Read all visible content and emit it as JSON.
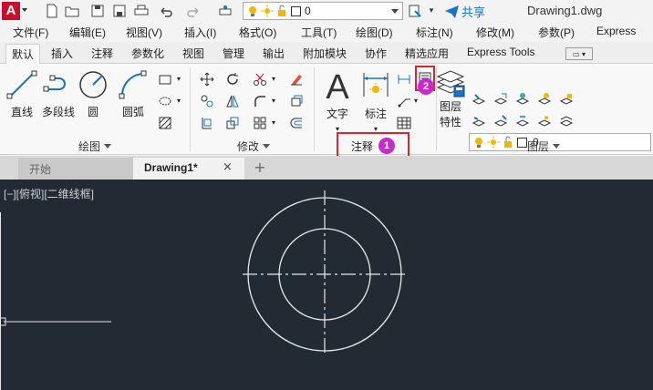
{
  "app": {
    "logo_letter": "A",
    "doc_title": "Drawing1.dwg",
    "share_label": "共享",
    "layer_value": "0"
  },
  "menu": [
    "文件(F)",
    "编辑(E)",
    "视图(V)",
    "插入(I)",
    "格式(O)",
    "工具(T)",
    "绘图(D)",
    "标注(N)",
    "修改(M)",
    "参数(P)",
    "Express"
  ],
  "ribbon_tabs": [
    "默认",
    "插入",
    "注释",
    "参数化",
    "视图",
    "管理",
    "输出",
    "附加模块",
    "协作",
    "精选应用",
    "Express Tools"
  ],
  "draw_panel": {
    "title": "绘图",
    "line": "直线",
    "polyline": "多段线",
    "circle": "圆",
    "arc": "圆弧"
  },
  "modify_panel": {
    "title": "修改"
  },
  "annotation_panel": {
    "title": "注释",
    "text": "文字",
    "dimension": "标注"
  },
  "layers_panel": {
    "title": "图层",
    "properties_line1": "图层",
    "properties_line2": "特性",
    "layer_value": "0"
  },
  "markers": {
    "badge1": "1",
    "badge2": "2"
  },
  "doc_tabs": {
    "start": "开始",
    "drawing": "Drawing1*",
    "close": "×",
    "add": "+"
  },
  "viewport": {
    "label": "[−][俯视][二维线框]"
  },
  "colors": {
    "canvas_bg": "#222a33",
    "highlight": "#e0242f",
    "badge": "#c72bd0",
    "accent_blue": "#1a73c8",
    "bulb_yellow": "#f2b705"
  }
}
